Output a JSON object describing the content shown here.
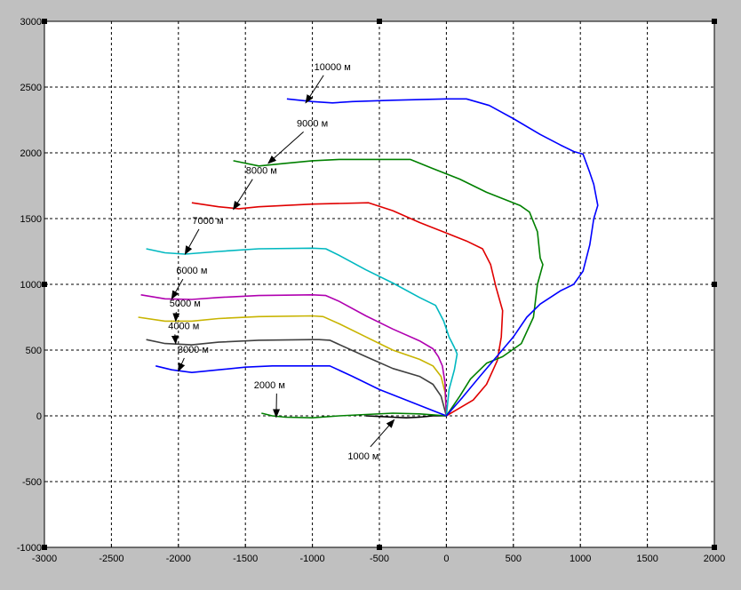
{
  "chart_data": {
    "type": "line",
    "title": "",
    "xlabel": "",
    "ylabel": "",
    "xlim": [
      -3000,
      2000
    ],
    "ylim": [
      -1000,
      3000
    ],
    "grid": true,
    "x_ticks": [
      -3000,
      -2500,
      -2000,
      -1500,
      -1000,
      -500,
      0,
      500,
      1000,
      1500,
      2000
    ],
    "y_ticks": [
      -1000,
      -500,
      0,
      500,
      1000,
      1500,
      2000,
      2500,
      3000
    ],
    "series": [
      {
        "color": "#000000",
        "points": [
          [
            -600,
            0
          ],
          [
            -500,
            -5
          ],
          [
            -400,
            -10
          ],
          [
            -300,
            -15
          ],
          [
            -200,
            -10
          ],
          [
            -100,
            0
          ],
          [
            0,
            0
          ]
        ]
      },
      {
        "color": "#008000",
        "points": [
          [
            -1380,
            20
          ],
          [
            -1300,
            0
          ],
          [
            -1200,
            -10
          ],
          [
            -1000,
            -15
          ],
          [
            -800,
            0
          ],
          [
            -600,
            10
          ],
          [
            -400,
            20
          ],
          [
            -200,
            15
          ],
          [
            0,
            0
          ]
        ]
      },
      {
        "color": "#0000ff",
        "points": [
          [
            -2170,
            380
          ],
          [
            -2050,
            350
          ],
          [
            -1900,
            330
          ],
          [
            -1700,
            350
          ],
          [
            -1500,
            370
          ],
          [
            -1300,
            380
          ],
          [
            -1100,
            380
          ],
          [
            -870,
            380
          ],
          [
            -700,
            300
          ],
          [
            -500,
            200
          ],
          [
            -300,
            120
          ],
          [
            -100,
            40
          ],
          [
            0,
            0
          ]
        ]
      },
      {
        "color": "#404040",
        "points": [
          [
            -2240,
            580
          ],
          [
            -2100,
            550
          ],
          [
            -1900,
            540
          ],
          [
            -1700,
            560
          ],
          [
            -1400,
            575
          ],
          [
            -1000,
            580
          ],
          [
            -950,
            580
          ],
          [
            -870,
            575
          ],
          [
            -600,
            450
          ],
          [
            -400,
            360
          ],
          [
            -200,
            300
          ],
          [
            -100,
            240
          ],
          [
            -40,
            150
          ],
          [
            0,
            0
          ]
        ]
      },
      {
        "color": "#c8b400",
        "points": [
          [
            -2300,
            750
          ],
          [
            -2100,
            720
          ],
          [
            -1900,
            720
          ],
          [
            -1700,
            740
          ],
          [
            -1400,
            755
          ],
          [
            -1000,
            760
          ],
          [
            -920,
            755
          ],
          [
            -800,
            700
          ],
          [
            -600,
            600
          ],
          [
            -400,
            500
          ],
          [
            -200,
            430
          ],
          [
            -100,
            380
          ],
          [
            -40,
            300
          ],
          [
            -10,
            180
          ],
          [
            0,
            0
          ]
        ]
      },
      {
        "color": "#b000b0",
        "points": [
          [
            -2280,
            920
          ],
          [
            -2100,
            890
          ],
          [
            -1900,
            885
          ],
          [
            -1700,
            900
          ],
          [
            -1400,
            915
          ],
          [
            -1000,
            920
          ],
          [
            -900,
            915
          ],
          [
            -800,
            870
          ],
          [
            -600,
            760
          ],
          [
            -400,
            660
          ],
          [
            -200,
            570
          ],
          [
            -100,
            510
          ],
          [
            -60,
            450
          ],
          [
            -30,
            380
          ],
          [
            -10,
            250
          ],
          [
            0,
            0
          ]
        ]
      },
      {
        "color": "#00b8c0",
        "points": [
          [
            -2240,
            1270
          ],
          [
            -2100,
            1240
          ],
          [
            -1950,
            1230
          ],
          [
            -1700,
            1250
          ],
          [
            -1400,
            1270
          ],
          [
            -1000,
            1275
          ],
          [
            -900,
            1270
          ],
          [
            -800,
            1220
          ],
          [
            -600,
            1110
          ],
          [
            -400,
            1010
          ],
          [
            -200,
            900
          ],
          [
            -80,
            840
          ],
          [
            -20,
            720
          ],
          [
            20,
            600
          ],
          [
            60,
            520
          ],
          [
            80,
            470
          ],
          [
            60,
            350
          ],
          [
            20,
            200
          ],
          [
            0,
            0
          ]
        ]
      },
      {
        "color": "#e00000",
        "points": [
          [
            -1900,
            1620
          ],
          [
            -1700,
            1590
          ],
          [
            -1550,
            1575
          ],
          [
            -1400,
            1590
          ],
          [
            -1000,
            1610
          ],
          [
            -580,
            1620
          ],
          [
            -400,
            1560
          ],
          [
            -200,
            1470
          ],
          [
            0,
            1390
          ],
          [
            150,
            1330
          ],
          [
            270,
            1270
          ],
          [
            330,
            1150
          ],
          [
            370,
            980
          ],
          [
            420,
            800
          ],
          [
            410,
            600
          ],
          [
            380,
            420
          ],
          [
            300,
            240
          ],
          [
            200,
            120
          ],
          [
            0,
            0
          ]
        ]
      },
      {
        "color": "#008000",
        "points": [
          [
            -1590,
            1940
          ],
          [
            -1400,
            1900
          ],
          [
            -1200,
            1920
          ],
          [
            -1000,
            1940
          ],
          [
            -800,
            1950
          ],
          [
            -400,
            1950
          ],
          [
            -270,
            1950
          ],
          [
            -100,
            1880
          ],
          [
            100,
            1800
          ],
          [
            300,
            1700
          ],
          [
            550,
            1600
          ],
          [
            620,
            1550
          ],
          [
            680,
            1400
          ],
          [
            700,
            1200
          ],
          [
            720,
            1150
          ],
          [
            680,
            1000
          ],
          [
            650,
            750
          ],
          [
            560,
            550
          ],
          [
            420,
            450
          ],
          [
            300,
            400
          ],
          [
            180,
            280
          ],
          [
            100,
            150
          ],
          [
            0,
            0
          ]
        ]
      },
      {
        "color": "#0000ff",
        "points": [
          [
            -1190,
            2410
          ],
          [
            -1000,
            2390
          ],
          [
            -850,
            2380
          ],
          [
            -700,
            2390
          ],
          [
            -400,
            2400
          ],
          [
            0,
            2410
          ],
          [
            150,
            2410
          ],
          [
            320,
            2360
          ],
          [
            500,
            2260
          ],
          [
            700,
            2140
          ],
          [
            850,
            2060
          ],
          [
            950,
            2010
          ],
          [
            1020,
            1990
          ],
          [
            1070,
            1850
          ],
          [
            1100,
            1760
          ],
          [
            1130,
            1600
          ],
          [
            1100,
            1500
          ],
          [
            1070,
            1300
          ],
          [
            1020,
            1100
          ],
          [
            950,
            1000
          ],
          [
            850,
            950
          ],
          [
            700,
            850
          ],
          [
            600,
            750
          ],
          [
            500,
            600
          ],
          [
            400,
            480
          ],
          [
            250,
            300
          ],
          [
            120,
            140
          ],
          [
            0,
            0
          ]
        ]
      }
    ],
    "annotations": [
      {
        "text": "10000 м",
        "tx": -850,
        "ty": 2630,
        "ax": -1050,
        "ay": 2380
      },
      {
        "text": "9000 м",
        "tx": -1000,
        "ty": 2200,
        "ax": -1330,
        "ay": 1920
      },
      {
        "text": "8000 м",
        "tx": -1380,
        "ty": 1840,
        "ax": -1590,
        "ay": 1570
      },
      {
        "text": "7000 м",
        "tx": -1780,
        "ty": 1460,
        "ax": -1950,
        "ay": 1230
      },
      {
        "text": "6000 м",
        "tx": -1900,
        "ty": 1080,
        "ax": -2050,
        "ay": 890
      },
      {
        "text": "5000 м",
        "tx": -1950,
        "ty": 830,
        "ax": -2020,
        "ay": 720
      },
      {
        "text": "4000 м",
        "tx": -1960,
        "ty": 660,
        "ax": -2020,
        "ay": 550
      },
      {
        "text": "3000 м",
        "tx": -1890,
        "ty": 480,
        "ax": -2000,
        "ay": 340
      },
      {
        "text": "2000 м",
        "tx": -1320,
        "ty": 210,
        "ax": -1270,
        "ay": -10
      },
      {
        "text": "1000 м",
        "tx": -620,
        "ty": -330,
        "ax": -390,
        "ay": -30
      }
    ]
  }
}
